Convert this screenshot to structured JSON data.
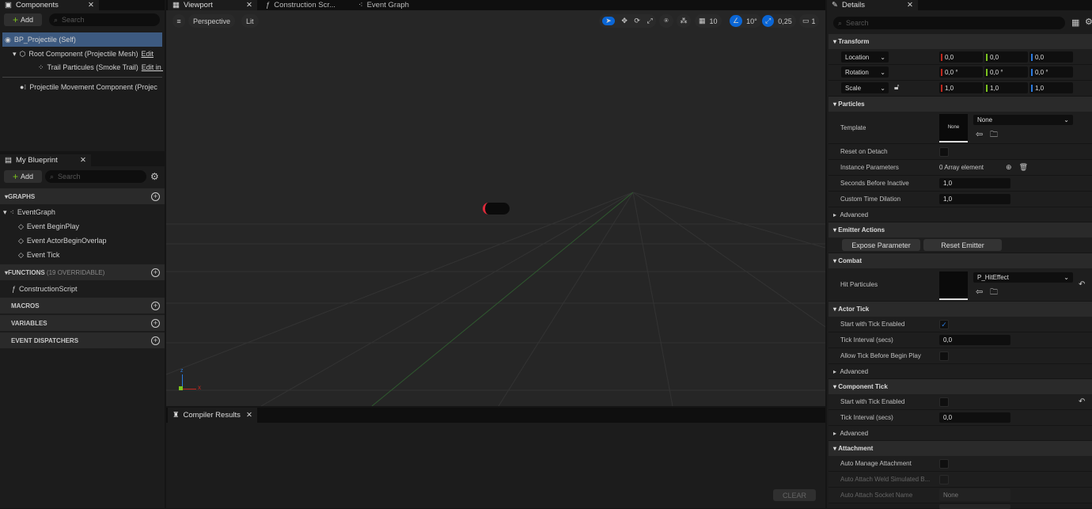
{
  "components": {
    "tab": "Components",
    "add": "Add",
    "search_placeholder": "Search",
    "items": [
      {
        "label": "BP_Projectile (Self)"
      },
      {
        "label": "Root Component (Projectile Mesh)",
        "link": "Edit"
      },
      {
        "label": "Trail Particules (Smoke Trail)",
        "link": "Edit in C"
      },
      {
        "label": "Projectile Movement Component (Projec"
      }
    ]
  },
  "my_blueprint": {
    "tab": "My Blueprint",
    "add": "Add",
    "search_placeholder": "Search",
    "graphs": "GRAPHS",
    "event_graph": "EventGraph",
    "events": [
      "Event BeginPlay",
      "Event ActorBeginOverlap",
      "Event Tick"
    ],
    "functions": "FUNCTIONS",
    "functions_count": "(19 OVERRIDABLE)",
    "construction": "ConstructionScript",
    "macros": "MACROS",
    "variables": "VARIABLES",
    "dispatchers": "EVENT DISPATCHERS"
  },
  "tabs": [
    "Viewport",
    "Construction Scr...",
    "Event Graph"
  ],
  "viewport": {
    "perspective": "Perspective",
    "lit": "Lit",
    "grid": "10",
    "angle": "10°",
    "scale": "0,25",
    "camera": "1",
    "axis_z": "z",
    "axis_x": "x"
  },
  "compiler": {
    "tab": "Compiler Results",
    "clear": "CLEAR"
  },
  "details": {
    "tab": "Details",
    "search_placeholder": "Search",
    "transform": "Transform",
    "location": {
      "label": "Location",
      "x": "0,0",
      "y": "0,0",
      "z": "0,0"
    },
    "rotation": {
      "label": "Rotation",
      "x": "0,0 °",
      "y": "0,0 °",
      "z": "0,0 °"
    },
    "scale": {
      "label": "Scale",
      "x": "1,0",
      "y": "1,0",
      "z": "1,0"
    },
    "particles": "Particles",
    "template": "Template",
    "template_thumb": "None",
    "template_value": "None",
    "reset_on_detach": "Reset on Detach",
    "instance_params": "Instance Parameters",
    "instance_value": "0 Array element",
    "seconds_inactive": "Seconds Before Inactive",
    "seconds_value": "1,0",
    "custom_dilation": "Custom Time Dilation",
    "dilation_value": "1,0",
    "advanced": "Advanced",
    "emitter_actions": "Emitter Actions",
    "expose": "Expose Parameter",
    "reset_emitter": "Reset Emitter",
    "combat": "Combat",
    "hit_particules": "Hit Particules",
    "hit_value": "P_HitEffect",
    "actor_tick": "Actor Tick",
    "start_tick": "Start with Tick Enabled",
    "start_tick_checked": true,
    "tick_interval": "Tick Interval (secs)",
    "tick_value": "0,0",
    "allow_tick": "Allow Tick Before Begin Play",
    "component_tick": "Component Tick",
    "comp_start_tick": "Start with Tick Enabled",
    "comp_start_checked": false,
    "comp_tick_interval": "Tick Interval (secs)",
    "comp_tick_value": "0,0",
    "attachment": "Attachment",
    "auto_manage": "Auto Manage Attachment",
    "auto_weld": "Auto Attach Weld Simulated B...",
    "socket_name": "Auto Attach Socket Name",
    "socket_value": "None"
  },
  "colors": {
    "accent": "#0a66d6",
    "selection": "#3d5a80",
    "x_axis": "#c0281e",
    "y_axis": "#7cc41e",
    "z_axis": "#2a7be0"
  }
}
